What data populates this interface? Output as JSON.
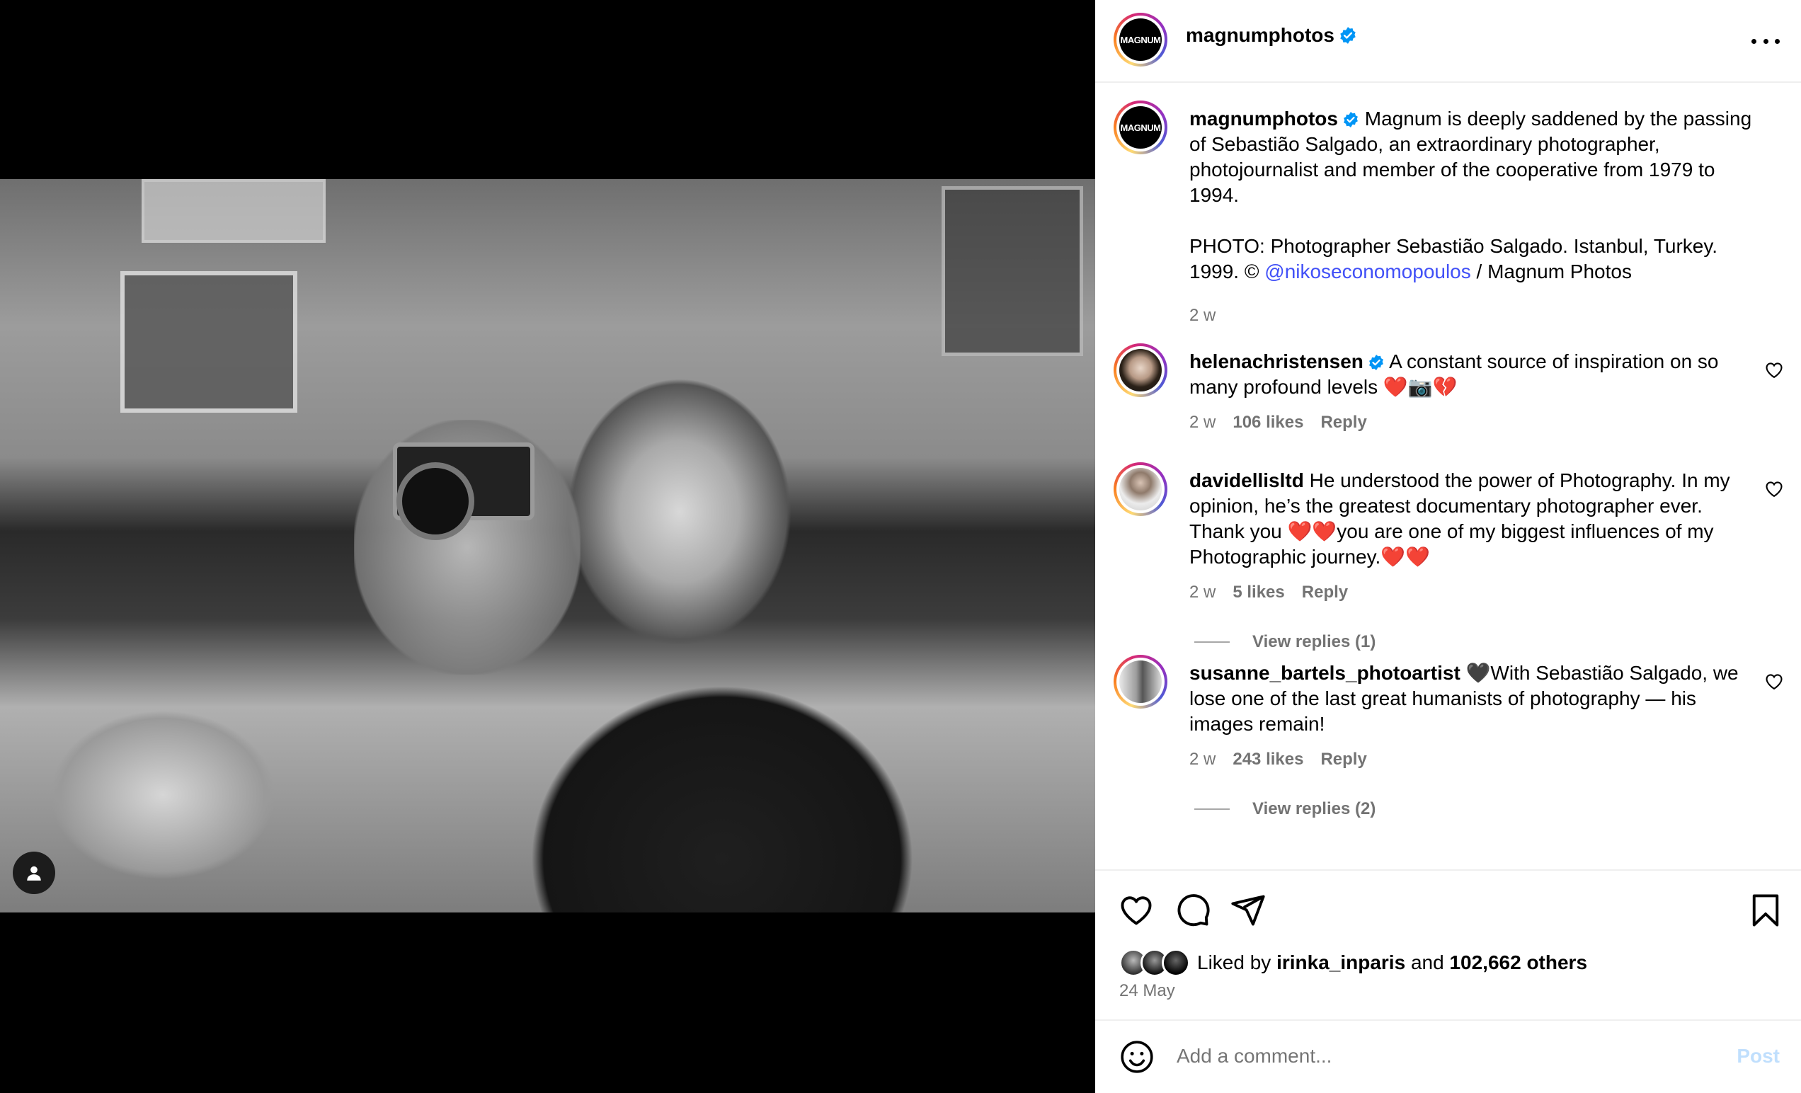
{
  "post": {
    "username": "magnumphotos",
    "avatar_text": "MAGNUM",
    "caption_line1": "Magnum is deeply saddened by the passing of Sebastião Salgado, an extraordinary photographer, photojournalist and member of the cooperative from 1979 to 1994.",
    "caption_photo_prefix": "PHOTO: Photographer Sebastião Salgado. Istanbul, Turkey. 1999. © ",
    "caption_mention": "@nikoseconomopoulos",
    "caption_photo_suffix": " / Magnum Photos",
    "caption_time": "2 w"
  },
  "comments": [
    {
      "username": "helenachristensen",
      "verified": true,
      "text": "A constant source of inspiration on so many profound levels ❤️📷💔",
      "time": "2 w",
      "likes": "106 likes",
      "reply": "Reply"
    },
    {
      "username": "davidellisltd",
      "verified": false,
      "text": "He understood the power of Photography. In my opinion, he’s the greatest documentary photographer ever. Thank you ❤️❤️you are one of my biggest influences of my Photographic journey.❤️❤️",
      "time": "2 w",
      "likes": "5 likes",
      "reply": "Reply",
      "view_replies": "View replies (1)"
    },
    {
      "username": "susanne_bartels_photoartist",
      "verified": false,
      "text": "🖤With Sebastião Salgado, we lose one of the last great humanists of photography — his images remain!",
      "time": "2 w",
      "likes": "243 likes",
      "reply": "Reply",
      "view_replies": "View replies (2)"
    }
  ],
  "likes": {
    "prefix": "Liked by ",
    "user": "irinka_inparis",
    "middle": " and ",
    "count": "102,662 others"
  },
  "date": "24 May",
  "comment_box": {
    "placeholder": "Add a comment...",
    "post_label": "Post"
  },
  "icons": {
    "more": "more-options-icon",
    "like": "heart-icon",
    "comment": "comment-icon",
    "share": "share-icon",
    "save": "bookmark-icon",
    "emoji": "emoji-icon",
    "user_tag": "user-tag-icon",
    "verified": "verified-badge-icon"
  },
  "colors": {
    "link": "#4150f7",
    "muted": "#737373",
    "verified": "#0095f6",
    "post_disabled": "#c0dffd"
  }
}
